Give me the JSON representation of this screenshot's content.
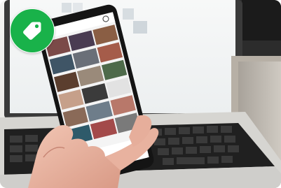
{
  "card": {
    "image_subject": "photo-hand-holding-smartphone-gallery-in-front-of-laptop",
    "badge_icon": "tag-icon",
    "badge_color": "#19b24a"
  }
}
